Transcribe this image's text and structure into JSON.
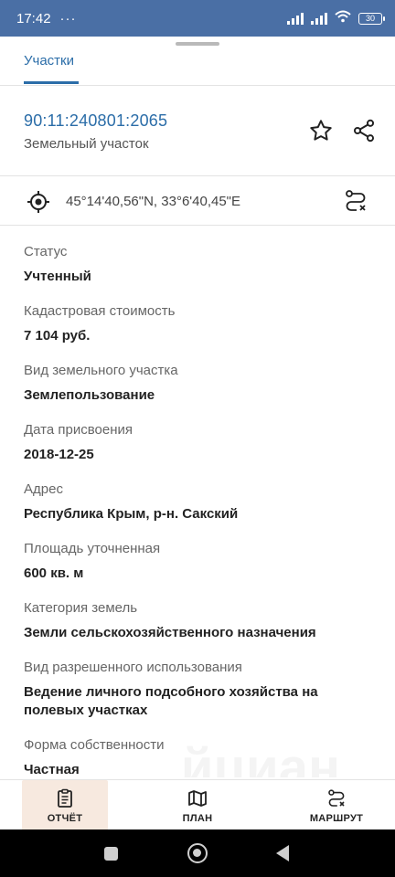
{
  "status_bar": {
    "time": "17:42",
    "dots": "···",
    "battery": "30"
  },
  "tabs": [
    {
      "label": "Участки"
    }
  ],
  "parcel": {
    "cadastral_number": "90:11:240801:2065",
    "type": "Земельный участок",
    "coordinates": "45°14'40,56\"N, 33°6'40,45\"E"
  },
  "fields": [
    {
      "label": "Статус",
      "value": "Учтенный"
    },
    {
      "label": "Кадастровая стоимость",
      "value": "7 104 руб."
    },
    {
      "label": "Вид земельного участка",
      "value": "Землепользование"
    },
    {
      "label": "Дата присвоения",
      "value": "2018-12-25"
    },
    {
      "label": "Адрес",
      "value": "Республика Крым, р-н. Сакский"
    },
    {
      "label": "Площадь уточненная",
      "value": "600 кв. м"
    },
    {
      "label": "Категория земель",
      "value": "Земли сельскохозяйственного назначения"
    },
    {
      "label": "Вид разрешенного использования",
      "value": "Ведение личного подсобного хозяйства на полевых участках"
    },
    {
      "label": "Форма собственности",
      "value": "Частная"
    }
  ],
  "watermark": "йциан",
  "bottom_nav": [
    {
      "label": "ОТЧЁТ",
      "icon": "report-icon"
    },
    {
      "label": "ПЛАН",
      "icon": "map-icon"
    },
    {
      "label": "МАРШРУТ",
      "icon": "route-icon"
    }
  ],
  "colors": {
    "status_bar": "#4a6fa5",
    "accent": "#2b6da8",
    "report_highlight": "#f7e9df"
  }
}
